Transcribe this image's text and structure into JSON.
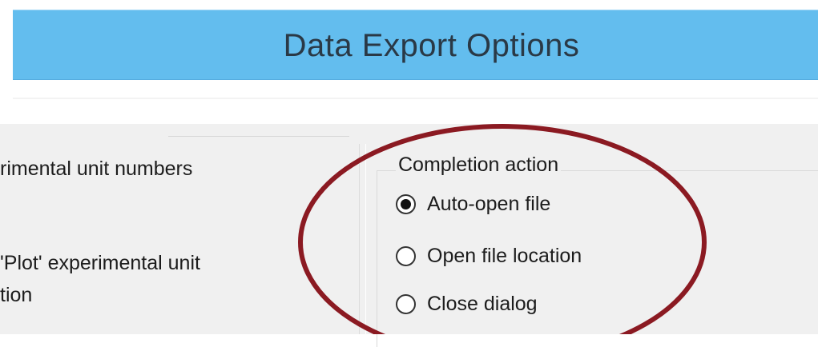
{
  "window": {
    "title": "Data Export Options"
  },
  "left_panel": {
    "option_1": "rimental unit numbers",
    "option_2_line1": "'Plot' experimental unit",
    "option_2_line2": "tion"
  },
  "completion_action": {
    "legend": "Completion action",
    "selected": "Auto-open file",
    "options": [
      {
        "label": "Auto-open file",
        "checked": true
      },
      {
        "label": "Open file location",
        "checked": false
      },
      {
        "label": "Close dialog",
        "checked": false
      }
    ]
  },
  "colors": {
    "title_bar": "#63bdee",
    "annotation_circle": "#8b1a22"
  }
}
